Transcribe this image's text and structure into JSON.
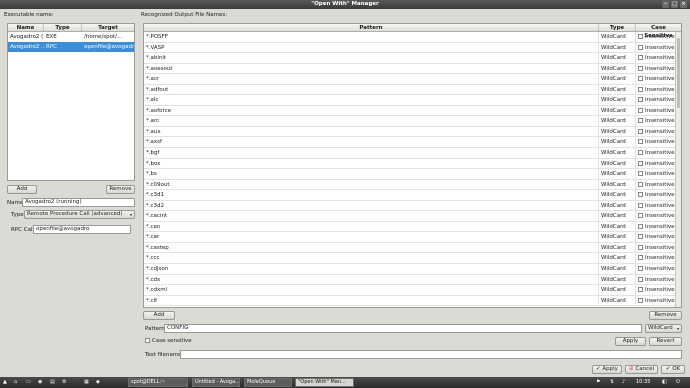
{
  "window": {
    "title": "\"Open With\" Manager",
    "controls": [
      "–",
      "□",
      "×"
    ]
  },
  "executables": {
    "section_label": "Executable name:",
    "columns": [
      "Name",
      "Type",
      "Target"
    ],
    "rows": [
      {
        "name": "Avogadro2 (...",
        "type": "EXE",
        "target": "/home/spot/..."
      },
      {
        "name": "Avogadro2 ...",
        "type": "RPC",
        "target": "openfile@avogadro"
      }
    ],
    "add_label": "Add",
    "remove_label": "Remove"
  },
  "details": {
    "name_label": "Name:",
    "name_value": "Avogadro2 (running)",
    "type_label": "Type:",
    "type_value": "Remote Procedure Call (advanced)",
    "rpc_label": "RPC Call:",
    "rpc_value": "openfile@avogadro"
  },
  "patterns": {
    "section_label": "Recognized Output File Names:",
    "columns": [
      "Pattern",
      "Type",
      "Case Sensitive"
    ],
    "rows": [
      "*.POSFF",
      "*.VASP",
      "*.abinit",
      "*.aoesout",
      "*.acr",
      "*.adfout",
      "*.alc",
      "*.aoforce",
      "*.arc",
      "*.aux",
      "*.axsf",
      "*.bgf",
      "*.box",
      "*.bs",
      "*.c09out",
      "*.c3d1",
      "*.c3d2",
      "*.cacint",
      "*.can",
      "*.car",
      "*.castep",
      "*.ccc",
      "*.cdjson",
      "*.cdx",
      "*.cdxml",
      "*.cif"
    ],
    "row_type": "WildCard",
    "row_case": "Insensitive",
    "add_label": "Add",
    "remove_label": "Remove"
  },
  "pattern_editor": {
    "pattern_label": "Pattern:",
    "pattern_value": "CONFIG",
    "pattern_type": "WildCard",
    "case_label": "Case sensitive",
    "apply_label": "Apply",
    "revert_label": "Revert",
    "test_label": "Test filename:",
    "test_value": ""
  },
  "dialog_buttons": {
    "apply": "Apply",
    "cancel": "Cancel",
    "ok": "OK"
  },
  "taskbar": {
    "tasks": [
      "spot@DELL:~",
      "Untitled - Avoga...",
      "MoleQueue",
      "\"Open With\" Man..."
    ],
    "clock": "10:35",
    "colors": {
      "bar": "#2a2a2a",
      "selection": "#3c8ed8"
    }
  }
}
